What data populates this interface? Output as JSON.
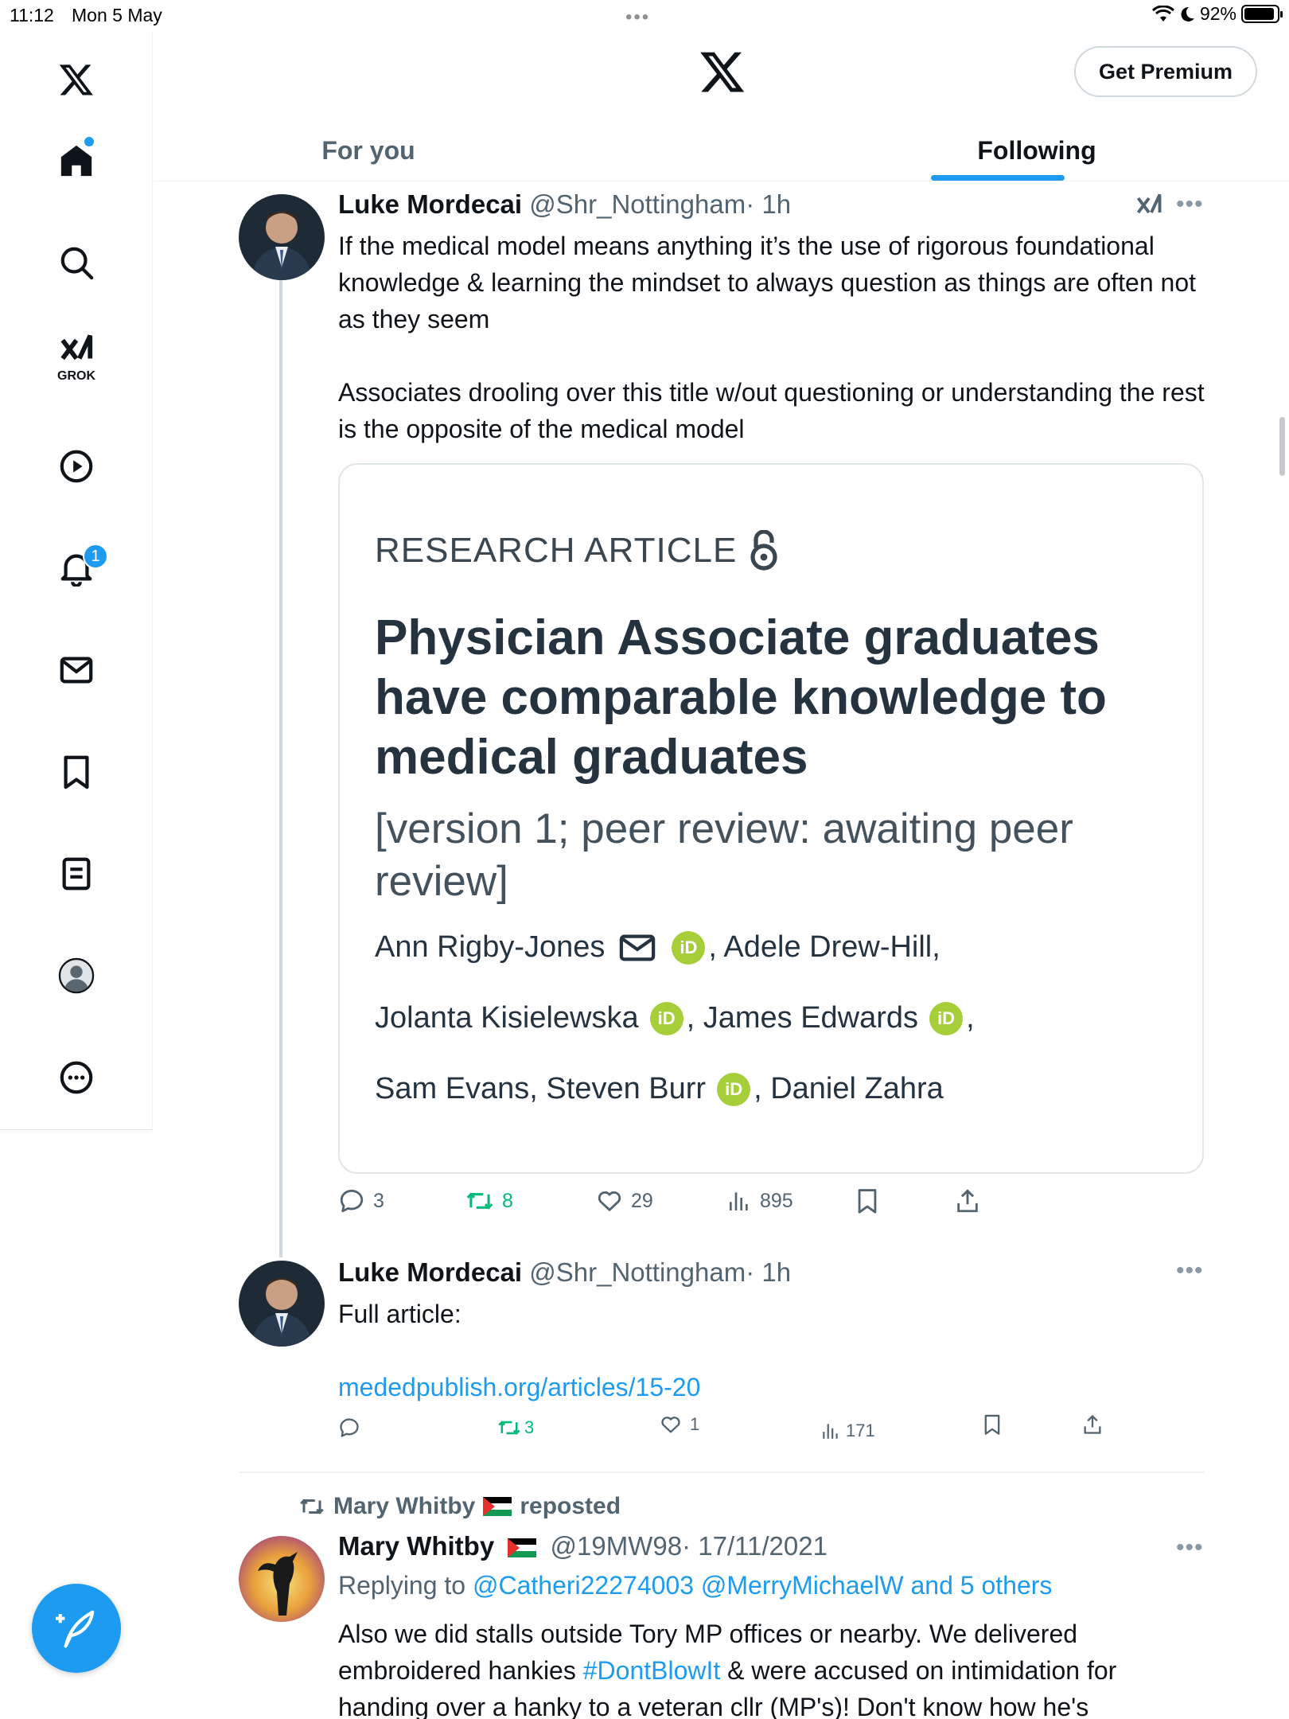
{
  "status_bar": {
    "time": "11:12",
    "date": "Mon 5 May",
    "battery": "92%",
    "battery_level": 0.92
  },
  "sidebar": {
    "grok_label": "GROK",
    "notification_count": "1"
  },
  "header": {
    "premium_label": "Get Premium",
    "tabs": [
      {
        "label": "For you",
        "active": false
      },
      {
        "label": "Following",
        "active": true
      }
    ]
  },
  "tweet1": {
    "name": "Luke Mordecai",
    "handle": "@Shr_Nottingham",
    "time": "· 1h",
    "paragraphs": [
      "If the medical model means anything it’s the use of rigorous foundational knowledge & learning the mindset to always question as things are often not as they seem",
      "Associates drooling over this title w/out questioning or understanding the rest is the opposite of the medical model"
    ],
    "card": {
      "kicker": "RESEARCH ARTICLE",
      "title": "Physician Associate graduates have comparable knowledge to medical graduates",
      "version": "[version 1; peer review: awaiting peer review]",
      "orcid_label": "iD",
      "authors": {
        "a1": "Ann Rigby-Jones",
        "a2": ", Adele Drew-Hill,",
        "a3": "Jolanta Kisielewska",
        "a4": ", James Edwards",
        "a4_end": ",",
        "a5": "Sam Evans, Steven Burr",
        "a6": ", Daniel Zahra"
      }
    },
    "stats": {
      "replies": "3",
      "reposts": "8",
      "likes": "29",
      "views": "895"
    }
  },
  "tweet2": {
    "name": "Luke Mordecai",
    "handle": "@Shr_Nottingham",
    "time": "· 1h",
    "text": "Full article:",
    "link": "mededpublish.org/articles/15-20",
    "stats": {
      "reposts": "3",
      "likes": "1",
      "views": "171"
    }
  },
  "tweet3": {
    "repost_name": "Mary Whitby",
    "repost_suffix": "reposted",
    "name": "Mary Whitby",
    "handle": "@19MW98",
    "time": "· 17/11/2021",
    "replying_prefix": "Replying to",
    "replying_to": "@Catheri22274003 @MerryMichaelW and 5 others",
    "text_before": "Also we did stalls outside Tory MP offices or nearby. We delivered embroidered hankies ",
    "hashtag": "#DontBlowIt",
    "text_after": " & were accused on intimidation for handing over a hanky to a veteran cllr (MP's)! Don't know how he's"
  },
  "colors": {
    "accent": "#1d9bf0",
    "repost_green": "#00ba7c",
    "orcid_green": "#a6ce39",
    "secondary_text": "#536471"
  },
  "icons": {
    "sidebar": [
      "x-logo-icon",
      "home-icon",
      "search-icon",
      "grok-icon",
      "video-icon",
      "bell-icon",
      "mail-icon",
      "bookmark-icon",
      "lists-icon",
      "profile-icon",
      "more-circle-icon"
    ],
    "compose": "compose-feather-icon"
  }
}
